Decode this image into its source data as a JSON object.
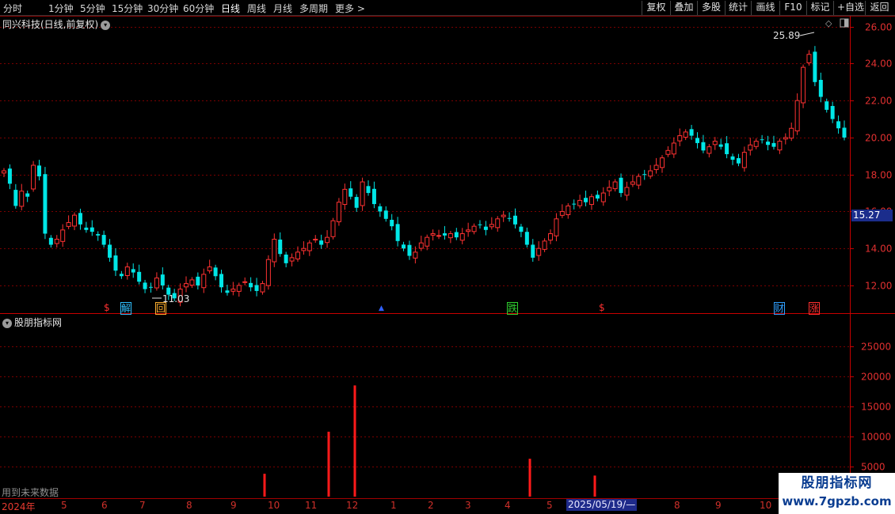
{
  "toolbar": {
    "periods": [
      "分时",
      "1分钟",
      "5分钟",
      "15分钟",
      "30分钟",
      "60分钟",
      "日线",
      "周线",
      "月线",
      "多周期",
      "更多 >"
    ],
    "active_period": "日线",
    "buttons": [
      "复权",
      "叠加",
      "多股",
      "统计",
      "画线",
      "F10",
      "标记",
      "+自选",
      "返回"
    ]
  },
  "main": {
    "title": "同兴科技(日线,前复权)",
    "high_label": "25.89",
    "low_label": "11.03",
    "current_price": "15.27",
    "price_ticks": [
      "26.00",
      "24.00",
      "22.00",
      "20.00",
      "18.00",
      "16.00",
      "14.00",
      "12.00"
    ],
    "markers": [
      {
        "text": "$",
        "color": "#ff3030"
      },
      {
        "text": "解",
        "color": "#30c0ff"
      },
      {
        "text": "回",
        "color": "#ffb030"
      },
      {
        "text": "▲",
        "color": "#3060ff"
      },
      {
        "text": "跌",
        "color": "#30d030"
      },
      {
        "text": "$",
        "color": "#ff3030"
      },
      {
        "text": "财",
        "color": "#30a0ff"
      },
      {
        "text": "涨",
        "color": "#ff3030"
      }
    ]
  },
  "indicator": {
    "title": "股朋指标网",
    "vol_ticks": [
      "25000",
      "20000",
      "15000",
      "10000",
      "5000"
    ],
    "future_note": "用到未来数据"
  },
  "time_axis": {
    "labels": [
      "2024年",
      "5",
      "6",
      "7",
      "8",
      "9",
      "10",
      "11",
      "12",
      "1",
      "2",
      "3",
      "4",
      "5",
      "7",
      "8",
      "9",
      "10"
    ],
    "cursor_date": "2025/05/19/—"
  },
  "watermark": {
    "title": "股朋指标网",
    "url": "www.7gpzb.com"
  },
  "chart_data": {
    "type": "candlestick",
    "ylim": [
      10.5,
      26.5
    ],
    "closes": [
      18.2,
      17.5,
      16.3,
      17.1,
      16.8,
      18.5,
      17.9,
      14.8,
      14.2,
      14.5,
      15.0,
      15.4,
      15.8,
      15.3,
      15.0,
      14.9,
      14.7,
      14.2,
      13.5,
      12.8,
      12.5,
      13.0,
      12.7,
      12.2,
      11.8,
      11.9,
      12.4,
      12.0,
      11.5,
      11.3,
      11.8,
      12.1,
      12.3,
      12.0,
      12.6,
      13.0,
      12.5,
      11.9,
      11.6,
      11.8,
      12.0,
      12.2,
      11.9,
      11.7,
      12.1,
      13.4,
      14.5,
      13.7,
      13.2,
      13.5,
      13.8,
      14.0,
      14.3,
      14.5,
      14.2,
      14.6,
      15.5,
      16.5,
      17.2,
      16.8,
      16.2,
      17.6,
      17.0,
      16.4,
      16.0,
      15.6,
      15.2,
      14.4,
      14.0,
      13.6,
      13.8,
      14.3,
      14.6,
      14.8,
      14.7,
      14.7,
      14.8,
      14.6,
      14.8,
      15.0,
      15.2,
      15.3,
      15.0,
      15.3,
      15.6,
      15.8,
      15.6,
      15.3,
      14.9,
      14.2,
      13.5,
      14.0,
      14.4,
      14.8,
      15.6,
      16.0,
      16.3,
      16.4,
      16.6,
      16.5,
      16.8,
      16.7,
      17.0,
      17.3,
      17.6,
      17.0,
      17.3,
      17.6,
      17.9,
      18.0,
      18.2,
      18.5,
      18.9,
      19.3,
      19.7,
      20.1,
      20.3,
      20.1,
      19.7,
      19.3,
      19.5,
      19.8,
      19.5,
      19.1,
      18.8,
      18.6,
      19.2,
      19.6,
      19.8,
      19.9,
      19.6,
      19.5,
      19.8,
      20.0,
      20.5,
      22.0,
      23.8,
      24.5,
      23.0,
      22.2,
      21.5,
      21.0,
      20.5,
      20.0
    ],
    "volume": [
      {
        "date": "2024-10",
        "value": 3800
      },
      {
        "date": "2024-11",
        "value": 10800
      },
      {
        "date": "2024-12",
        "value": 18500
      },
      {
        "date": "2025-04",
        "value": 6300
      },
      {
        "date": "2025-05",
        "value": 3500
      }
    ],
    "vlim": [
      0,
      30000
    ]
  },
  "colors": {
    "up": "#ff3232",
    "down": "#00e6e6",
    "grid": "#7a0000",
    "axis": "#c80000",
    "current_price_bg": "#1b2d8c"
  }
}
